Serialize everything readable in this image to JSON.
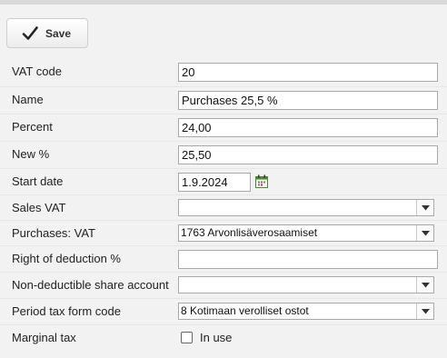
{
  "toolbar": {
    "save_label": "Save"
  },
  "form": {
    "vat_code": {
      "label": "VAT code",
      "value": "20"
    },
    "name": {
      "label": "Name",
      "value": "Purchases 25,5 %"
    },
    "percent": {
      "label": "Percent",
      "value": "24,00"
    },
    "new_percent": {
      "label": "New %",
      "value": "25,50"
    },
    "start_date": {
      "label": "Start date",
      "value": "1.9.2024"
    },
    "sales_vat": {
      "label": "Sales VAT",
      "value": ""
    },
    "purchases_vat": {
      "label": "Purchases: VAT",
      "value": "1763 Arvonlisäverosaamiset"
    },
    "right_of_deduction": {
      "label": "Right of deduction %",
      "value": ""
    },
    "non_deductible_account": {
      "label": "Non-deductible share account",
      "value": ""
    },
    "period_tax_form_code": {
      "label": "Period tax form code",
      "value": "8 Kotimaan verolliset ostot"
    },
    "marginal_tax": {
      "label": "Marginal tax",
      "checkbox_label": "In use",
      "checked": false
    }
  },
  "icons": {
    "save": "checkmark-icon",
    "calendar": "calendar-icon",
    "dropdown": "chevron-down-icon"
  },
  "colors": {
    "calendar_icon": "#4a8a2a"
  }
}
